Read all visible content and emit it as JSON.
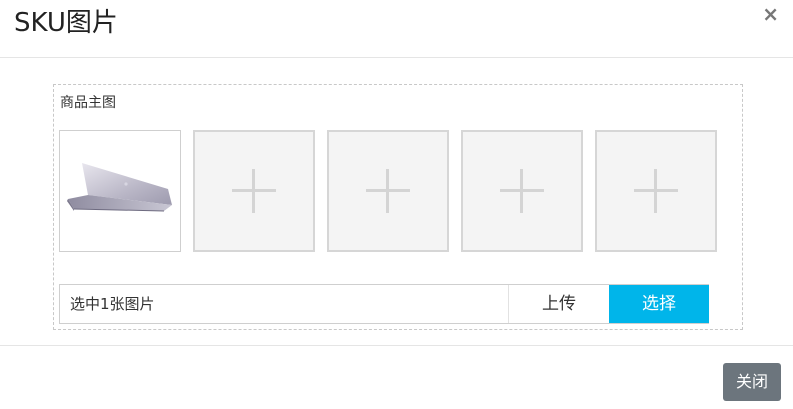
{
  "modal": {
    "title": "SKU图片",
    "close_symbol": "×",
    "close_button_label": "关闭"
  },
  "image_section": {
    "label": "商品主图",
    "images": [
      {
        "type": "image",
        "icon": "laptop-image"
      },
      {
        "type": "placeholder",
        "icon": "plus-icon"
      },
      {
        "type": "placeholder",
        "icon": "plus-icon"
      },
      {
        "type": "placeholder",
        "icon": "plus-icon"
      },
      {
        "type": "placeholder",
        "icon": "plus-icon"
      }
    ]
  },
  "uploader": {
    "status_text": "选中1张图片",
    "upload_label": "上传",
    "select_label": "选择"
  },
  "colors": {
    "accent": "#00b5ea",
    "secondary_button": "#6c757d"
  }
}
